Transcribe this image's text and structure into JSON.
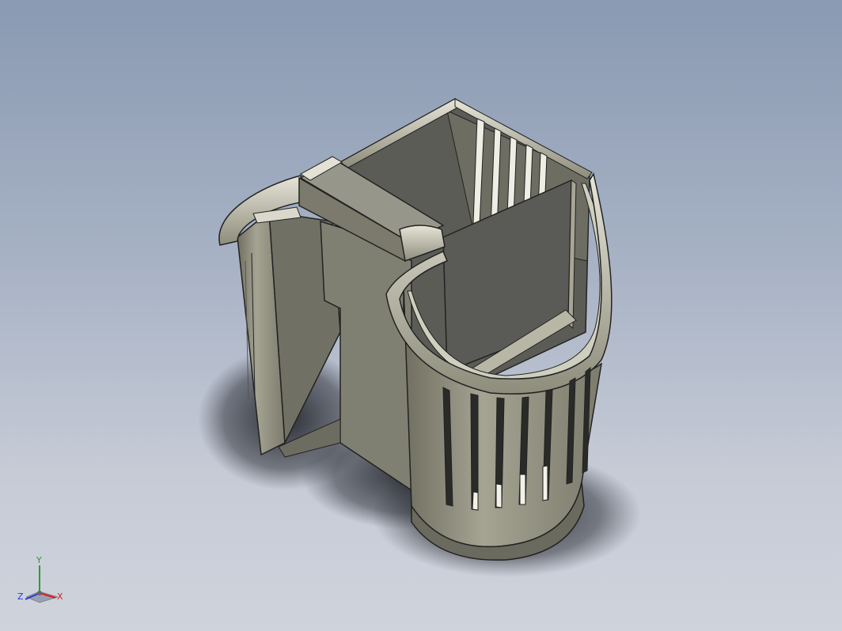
{
  "viewport": {
    "background_top": "#8a9ab2",
    "background_bottom": "#cfd3dc",
    "model": "basket-holder-part",
    "model_color": "#8c8b7a"
  },
  "triad": {
    "x_label": "X",
    "y_label": "Y",
    "z_label": "Z",
    "x_color": "#d42020",
    "y_color": "#2aa02a",
    "z_color": "#2a3ad0"
  }
}
